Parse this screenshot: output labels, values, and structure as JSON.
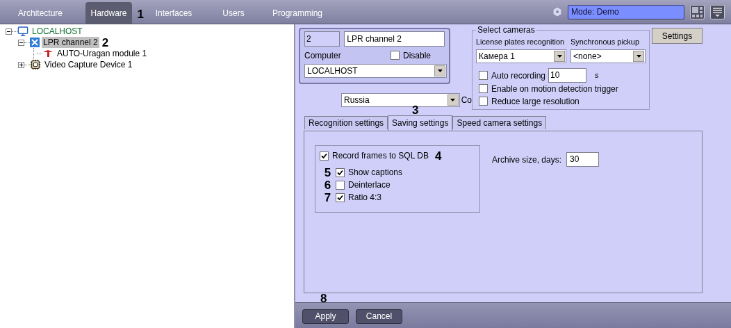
{
  "top_tabs": [
    {
      "label": "Architecture",
      "selected": false
    },
    {
      "label": "Hardware",
      "selected": true,
      "callout": "1"
    },
    {
      "label": "Interfaces",
      "selected": false
    },
    {
      "label": "Users",
      "selected": false
    },
    {
      "label": "Programming",
      "selected": false
    }
  ],
  "mode": {
    "value": "Mode: Demo"
  },
  "tree": [
    {
      "label": "LOCALHOST",
      "kind": "computer",
      "expanded": true,
      "selected": false,
      "children": [
        {
          "label": "LPR channel 2",
          "kind": "lpr",
          "expanded": true,
          "selected": true,
          "callout": "2",
          "children": [
            {
              "label": "AUTO-Uragan module 1",
              "kind": "module",
              "selected": false
            }
          ]
        },
        {
          "label": "Video Capture Device 1",
          "kind": "capture",
          "expanded": false,
          "selected": false
        }
      ]
    }
  ],
  "channel": {
    "id": "2",
    "name": "LPR channel 2",
    "computer_label": "Computer",
    "disable": {
      "label": "Disable",
      "checked": false
    },
    "computer": "LOCALHOST"
  },
  "country": {
    "value": "Russia",
    "cut_label": "Co"
  },
  "select_cameras": {
    "title": "Select cameras",
    "recognition_label": "License plates recognition",
    "recognition": "Камера 1",
    "pickup_label": "Synchronous pickup",
    "pickup": "<none>",
    "auto_recording": {
      "label": "Auto recording",
      "checked": false,
      "value": "10",
      "unit": "s"
    },
    "options": [
      {
        "label": "Enable on motion detection trigger",
        "checked": false
      },
      {
        "label": "Reduce large resolution",
        "checked": false
      }
    ]
  },
  "settings_button": "Settings",
  "tabs": [
    {
      "label": "Recognition settings",
      "selected": false
    },
    {
      "label": "Saving settings",
      "selected": true,
      "callout": "3"
    },
    {
      "label": "Speed camera settings",
      "selected": false
    }
  ],
  "saving": {
    "record": {
      "label": "Record frames to SQL DB",
      "checked": true,
      "callout": "4"
    },
    "options": [
      {
        "label": "Show captions",
        "checked": true,
        "callout": "5"
      },
      {
        "label": "Deinterlace",
        "checked": false,
        "callout": "6"
      },
      {
        "label": "Ratio 4:3",
        "checked": true,
        "callout": "7"
      }
    ],
    "archive_label": "Archive size, days:",
    "archive_value": "30"
  },
  "buttons": [
    {
      "label": "Apply",
      "callout": "8"
    },
    {
      "label": "Cancel"
    }
  ]
}
